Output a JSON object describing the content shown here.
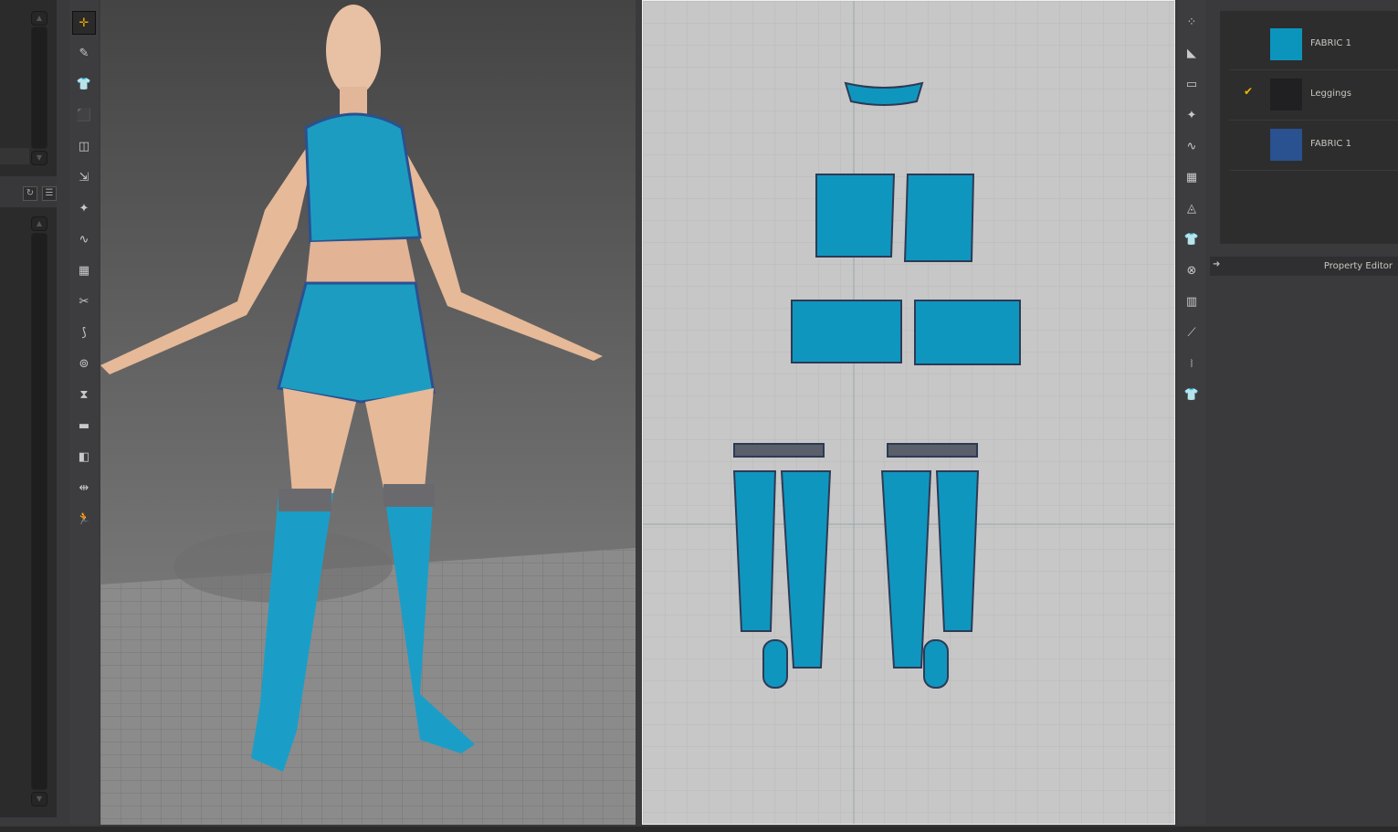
{
  "materials": [
    {
      "name": "FABRIC 1",
      "color": "#0b95bd",
      "checked": false
    },
    {
      "name": "Leggings",
      "color": "#202022",
      "checked": true
    },
    {
      "name": "FABRIC 1",
      "color": "#2a5190",
      "checked": false
    }
  ],
  "property_editor": {
    "title": "Property Editor"
  },
  "left_toolbar": {
    "tools": [
      "select-move",
      "transform",
      "simulate",
      "avatar-garment",
      "fold",
      "arrange",
      "pin",
      "tack",
      "edit-uv",
      "sewing",
      "strap",
      "button",
      "zip",
      "topstitch",
      "fit",
      "measure",
      "pose"
    ]
  },
  "colors": {
    "fabric": "#0b95bd",
    "trim": "#2a5190",
    "accent": "#e8a400"
  }
}
